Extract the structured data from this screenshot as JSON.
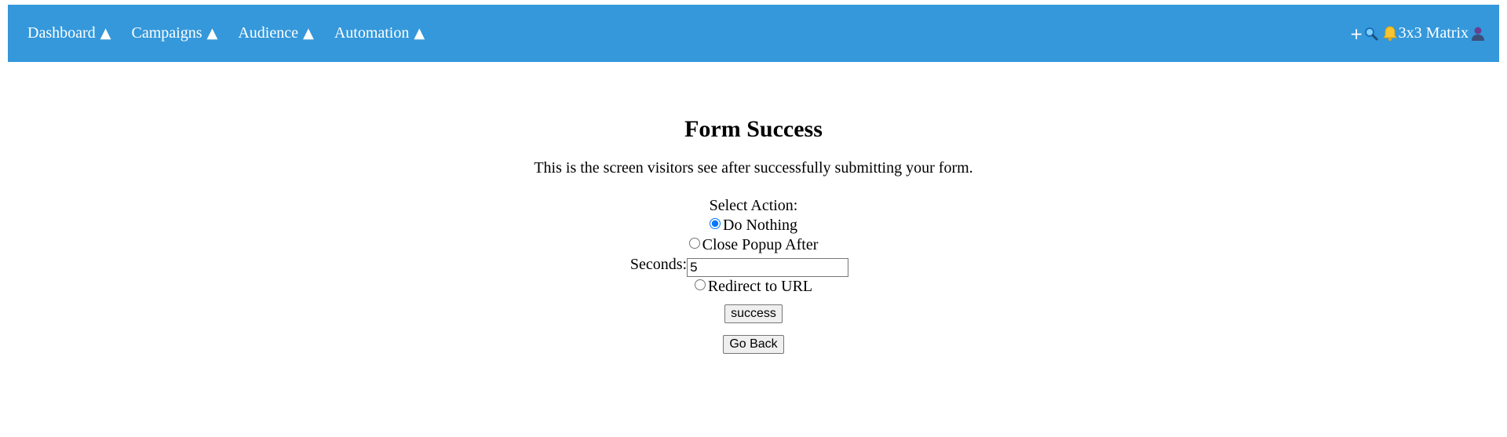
{
  "nav": {
    "items": [
      {
        "label": "Dashboard",
        "caret": "▲"
      },
      {
        "label": "Campaigns",
        "caret": "▲"
      },
      {
        "label": "Audience",
        "caret": "▲"
      },
      {
        "label": "Automation",
        "caret": "▲"
      }
    ],
    "right": {
      "plus": "+",
      "search_icon": "search-icon",
      "bell_icon": "bell-icon",
      "account_name": "3x3 Matrix",
      "user_icon": "user-icon"
    },
    "bar_color": "#3498db"
  },
  "page": {
    "title": "Form Success",
    "description": "This is the screen visitors see after successfully submitting your form."
  },
  "form": {
    "select_label": "Select Action:",
    "options": [
      {
        "label": "Do Nothing",
        "checked": true
      },
      {
        "label": "Close Popup After",
        "checked": false
      },
      {
        "label": "Redirect to URL",
        "checked": false
      }
    ],
    "seconds_label": "Seconds:",
    "seconds_value": "5"
  },
  "buttons": {
    "submit_label": "success",
    "back_label": "Go Back"
  }
}
